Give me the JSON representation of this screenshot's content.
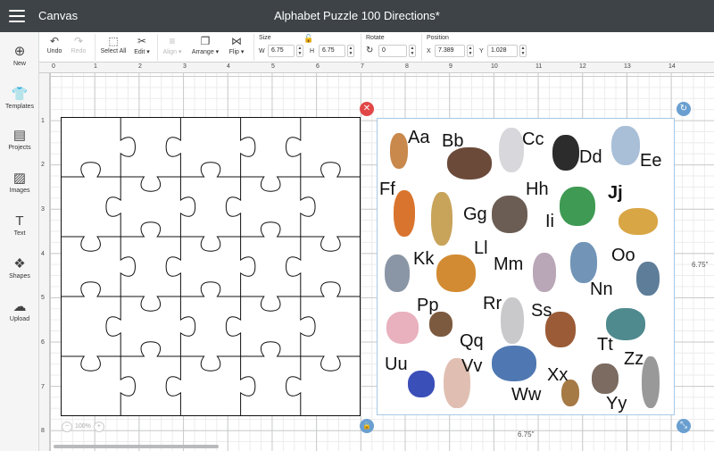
{
  "topbar": {
    "app_name": "Canvas",
    "document_title": "Alphabet Puzzle 100 Directions*"
  },
  "toolbar": {
    "undo": "Undo",
    "redo": "Redo",
    "select_all": "Select All",
    "edit": "Edit",
    "align": "Align",
    "arrange": "Arrange",
    "flip": "Flip",
    "size_label": "Size",
    "w_label": "W",
    "w_value": "6.75",
    "h_label": "H",
    "h_value": "6.75",
    "rotate_label": "Rotate",
    "rotate_value": "0",
    "position_label": "Position",
    "x_label": "X",
    "x_value": "7.389",
    "y_label": "Y",
    "y_value": "1.028"
  },
  "sidebar": {
    "items": [
      "New",
      "Templates",
      "Projects",
      "Images",
      "Text",
      "Shapes",
      "Upload"
    ]
  },
  "rulers": {
    "horizontal": [
      "0",
      "1",
      "2",
      "3",
      "4",
      "5",
      "6",
      "7",
      "8",
      "9",
      "10",
      "11",
      "12",
      "13",
      "14"
    ],
    "vertical": [
      "1",
      "2",
      "3",
      "4",
      "5",
      "6",
      "7",
      "8"
    ]
  },
  "dimensions": {
    "width": "6.75\"",
    "height": "6.75\""
  },
  "zoom": {
    "value": "100%"
  },
  "artboard": {
    "letters": [
      "Aa",
      "Bb",
      "Cc",
      "Dd",
      "Ee",
      "Ff",
      "Gg",
      "Hh",
      "Ii",
      "Jj",
      "Kk",
      "Ll",
      "Mm",
      "Nn",
      "Oo",
      "Pp",
      "Qq",
      "Rr",
      "Ss",
      "Tt",
      "Uu",
      "Vv",
      "Ww",
      "Xx",
      "Yy",
      "Zz"
    ]
  },
  "colors": {
    "topbar": "#3d4347",
    "selection_border": "#a5c8e6",
    "delete_handle": "#e14747",
    "blue_handle": "#6a9fd0"
  }
}
